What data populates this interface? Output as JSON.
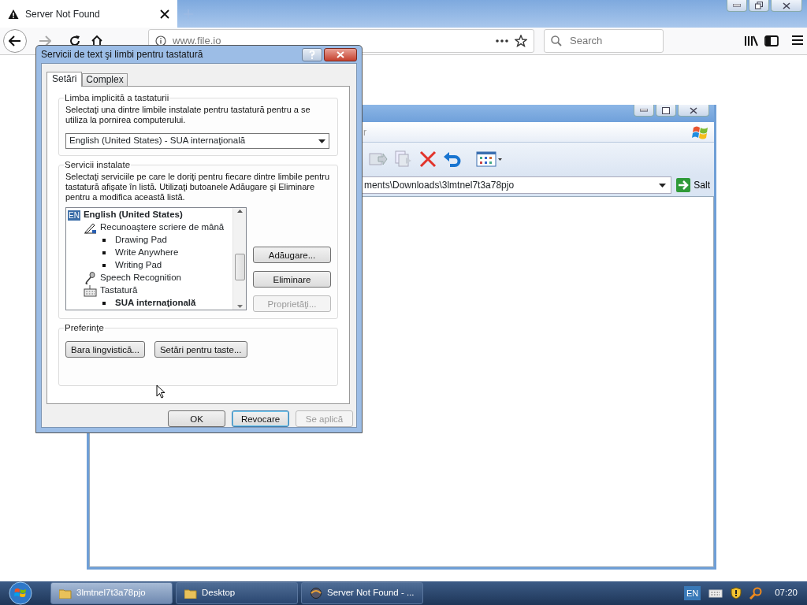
{
  "browser": {
    "tab": {
      "title": "Server Not Found"
    },
    "url": "www.file.io",
    "search": {
      "placeholder": "Search"
    }
  },
  "explorer": {
    "menu_fragment": "r",
    "address": "ments\\Downloads\\3lmtnel7t3a78pjo",
    "go_button": "Salt"
  },
  "dialog": {
    "title": "Servicii de text şi limbi pentru tastatură",
    "tabs": [
      {
        "label": "Setări",
        "selected": true
      },
      {
        "label": "Complex",
        "selected": false
      }
    ],
    "default_language": {
      "legend": "Limba implicită a tastaturii",
      "description": "Selectaţi una dintre limbile instalate pentru tastatură pentru a se utiliza la pornirea computerului.",
      "value": "English (United States) - SUA internaţională"
    },
    "installed_services": {
      "legend": "Servicii instalate",
      "description": "Selectaţi serviciile pe care le doriţi pentru fiecare dintre limbile pentru tastatură afişate în listă. Utilizaţi butoanele Adăugare şi Eliminare pentru a modifica această listă.",
      "tree": [
        {
          "kind": "language",
          "badge": "EN",
          "label": "English (United States)",
          "children": [
            {
              "kind": "handwriting",
              "label": "Recunoaştere scriere de mână",
              "children": [
                {
                  "kind": "item",
                  "label": "Drawing Pad",
                  "bold": false
                },
                {
                  "kind": "item",
                  "label": "Write Anywhere",
                  "bold": false
                },
                {
                  "kind": "item",
                  "label": "Writing Pad",
                  "bold": false
                }
              ]
            },
            {
              "kind": "speech",
              "label": "Speech Recognition"
            },
            {
              "kind": "keyboard",
              "label": "Tastatură",
              "children": [
                {
                  "kind": "item",
                  "label": "SUA internaţională",
                  "bold": true
                }
              ]
            }
          ]
        }
      ],
      "buttons": [
        {
          "label": "Adăugare...",
          "disabled": false
        },
        {
          "label": "Eliminare",
          "disabled": false
        },
        {
          "label": "Proprietăţi...",
          "disabled": true
        }
      ]
    },
    "preferences": {
      "legend": "Preferinţe",
      "buttons": [
        "Bara lingvistică...",
        "Setări pentru taste..."
      ]
    },
    "footer_buttons": [
      {
        "label": "OK",
        "disabled": false,
        "default": false
      },
      {
        "label": "Revocare",
        "disabled": false,
        "default": true
      },
      {
        "label": "Se aplică",
        "disabled": true,
        "default": false
      }
    ]
  },
  "taskbar": {
    "items": [
      {
        "kind": "folder",
        "label": "3lmtnel7t3a78pjo",
        "selected": true
      },
      {
        "kind": "folder",
        "label": "Desktop",
        "selected": false
      },
      {
        "kind": "browser",
        "label": "Server Not Found - ...",
        "selected": false
      }
    ],
    "language": "EN",
    "clock": "07:20"
  }
}
